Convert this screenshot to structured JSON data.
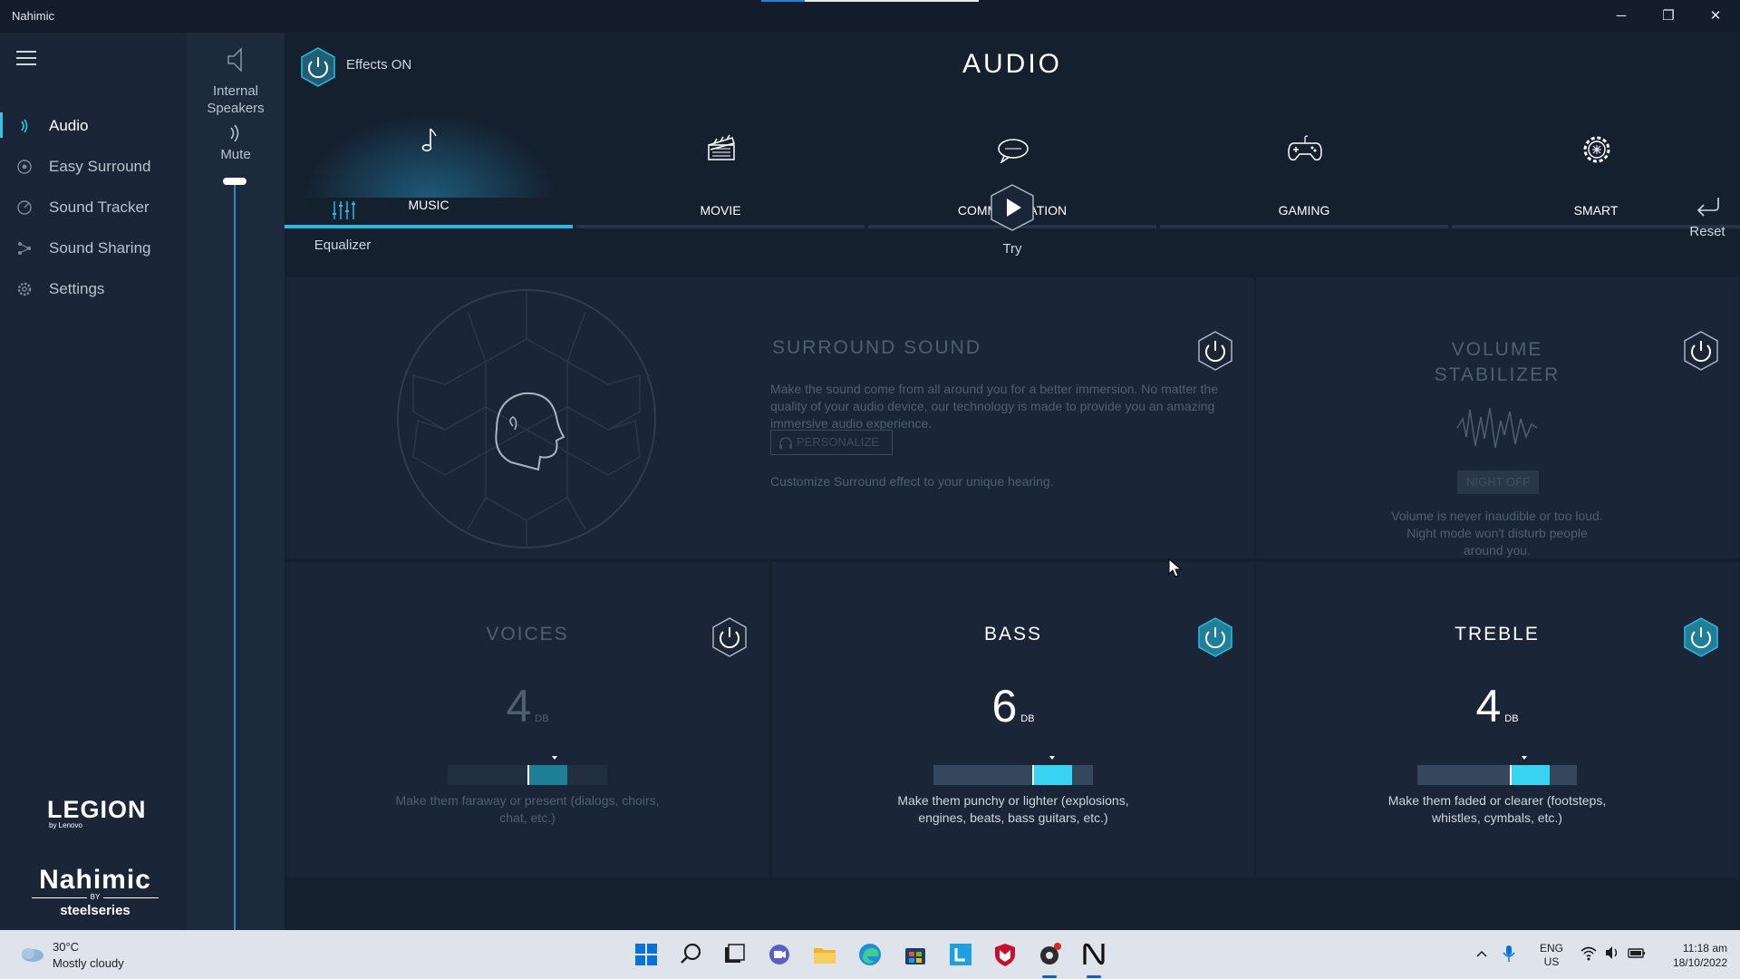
{
  "window": {
    "title": "Nahimic",
    "minimize_glyph": "─",
    "restore_glyph": "❐",
    "close_glyph": "✕"
  },
  "sidebar": {
    "items": [
      {
        "label": "Audio",
        "icon": "audio-wave-icon",
        "active": true
      },
      {
        "label": "Easy Surround",
        "icon": "surround-icon",
        "active": false
      },
      {
        "label": "Sound Tracker",
        "icon": "radar-icon",
        "active": false
      },
      {
        "label": "Sound Sharing",
        "icon": "share-icon",
        "active": false
      },
      {
        "label": "Settings",
        "icon": "gear-icon",
        "active": false
      }
    ],
    "legion_logo": "LEGION",
    "legion_sub": "by Lenovo",
    "nahimic_logo": "Nahimic",
    "nahimic_by": "BY",
    "steelseries": "steelseries"
  },
  "device": {
    "name_line1": "Internal",
    "name_line2": "Speakers",
    "mute_label": "Mute",
    "volume_level": 1.0
  },
  "header": {
    "effects_label": "Effects ON",
    "title": "AUDIO"
  },
  "tabs": [
    {
      "label": "MUSIC",
      "icon": "music-note-icon",
      "active": true
    },
    {
      "label": "MOVIE",
      "icon": "clapperboard-icon",
      "active": false
    },
    {
      "label": "COMMUNICATION",
      "icon": "chat-bubble-icon",
      "active": false
    },
    {
      "label": "GAMING",
      "icon": "gamepad-icon",
      "active": false
    },
    {
      "label": "SMART",
      "icon": "smart-gear-icon",
      "active": false
    }
  ],
  "toolbar": {
    "equalizer_label": "Equalizer",
    "try_label": "Try",
    "reset_label": "Reset"
  },
  "surround": {
    "title": "SURROUND SOUND",
    "description": "Make the sound come from all around you for a better immersion. No matter the quality of your audio device, our technology is made to provide you an amazing immersive audio experience.",
    "personalize_label": "PERSONALIZE",
    "customize_text": "Customize Surround effect to your unique hearing.",
    "enabled": false
  },
  "volume_stabilizer": {
    "title_line1": "VOLUME",
    "title_line2": "STABILIZER",
    "night_label": "NIGHT OFF",
    "description": "Volume is never inaudible or too loud. Night mode won't disturb people around you.",
    "enabled": false
  },
  "voices": {
    "title": "VOICES",
    "value": "4",
    "unit": "DB",
    "level": 0.5,
    "description": "Make them faraway or present (dialogs, choirs, chat, etc.)",
    "enabled": false
  },
  "bass": {
    "title": "BASS",
    "value": "6",
    "unit": "DB",
    "level": 0.62,
    "description": "Make them punchy or lighter (explosions, engines, beats, bass guitars, etc.)",
    "enabled": true
  },
  "treble": {
    "title": "TREBLE",
    "value": "4",
    "unit": "DB",
    "level": 0.58,
    "description": "Make them faded or clearer (footsteps, whistles, cymbals, etc.)",
    "enabled": true
  },
  "taskbar": {
    "weather_temp": "30°C",
    "weather_desc": "Mostly cloudy",
    "lang_line1": "ENG",
    "lang_line2": "US",
    "time": "11:18 am",
    "date": "18/10/2022"
  },
  "colors": {
    "accent": "#2fb8e0",
    "slider_active": "#36d4f2",
    "slider_inactive": "#1f7f96",
    "background": "#15202f",
    "card": "#1a2637"
  }
}
